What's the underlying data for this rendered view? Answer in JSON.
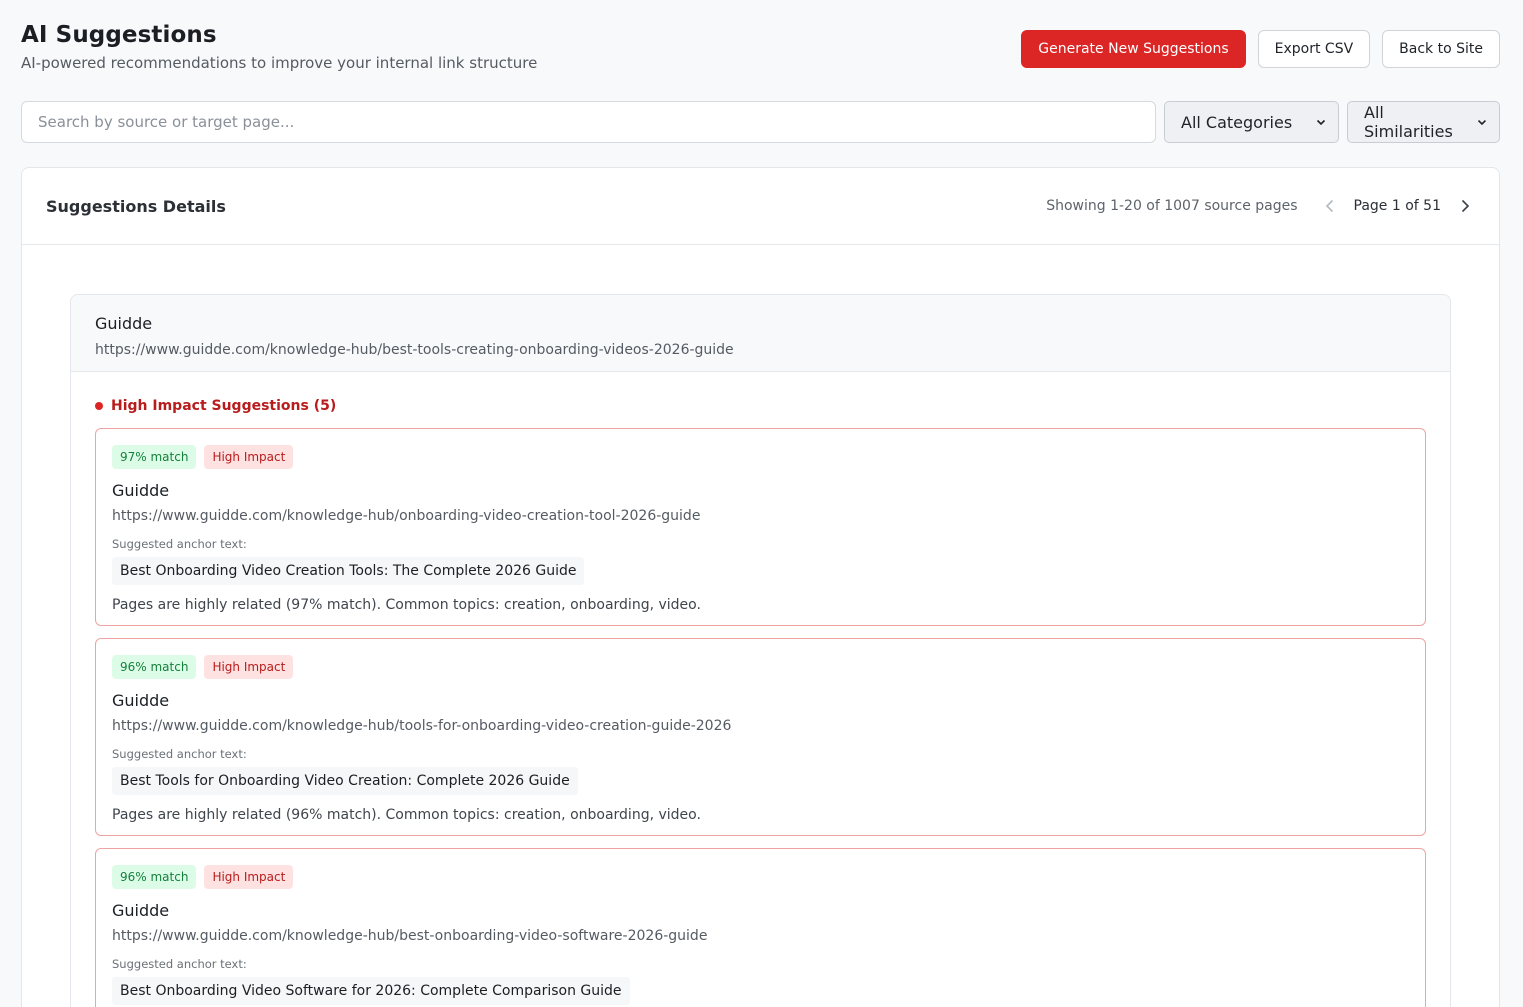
{
  "header": {
    "title": "AI Suggestions",
    "subtitle": "AI-powered recommendations to improve your internal link structure"
  },
  "actions": {
    "generate_label": "Generate New Suggestions",
    "export_label": "Export CSV",
    "back_label": "Back to Site"
  },
  "filters": {
    "search_placeholder": "Search by source or target page...",
    "category_selected": "All Categories",
    "similarity_selected": "All Similarities"
  },
  "panel": {
    "title": "Suggestions Details",
    "showing": "Showing 1-20 of 1007 source pages",
    "page": "Page 1 of 51"
  },
  "source": {
    "name": "Guidde",
    "url": "https://www.guidde.com/knowledge-hub/best-tools-creating-onboarding-videos-2026-guide"
  },
  "group": {
    "label": "High Impact Suggestions (5)"
  },
  "anchor_label": "Suggested anchor text:",
  "suggestions": [
    {
      "match": "97% match",
      "impact": "High Impact",
      "name": "Guidde",
      "url": "https://www.guidde.com/knowledge-hub/onboarding-video-creation-tool-2026-guide",
      "anchor": "Best Onboarding Video Creation Tools: The Complete 2026 Guide",
      "reason": "Pages are highly related (97% match). Common topics: creation, onboarding, video."
    },
    {
      "match": "96% match",
      "impact": "High Impact",
      "name": "Guidde",
      "url": "https://www.guidde.com/knowledge-hub/tools-for-onboarding-video-creation-guide-2026",
      "anchor": "Best Tools for Onboarding Video Creation: Complete 2026 Guide",
      "reason": "Pages are highly related (96% match). Common topics: creation, onboarding, video."
    },
    {
      "match": "96% match",
      "impact": "High Impact",
      "name": "Guidde",
      "url": "https://www.guidde.com/knowledge-hub/best-onboarding-video-software-2026-guide",
      "anchor": "Best Onboarding Video Software for 2026: Complete Comparison Guide",
      "reason": ""
    }
  ],
  "colors": {
    "accent": "#dc2626",
    "match_bg": "#dcfce7",
    "impact_bg": "#fee2e2"
  }
}
